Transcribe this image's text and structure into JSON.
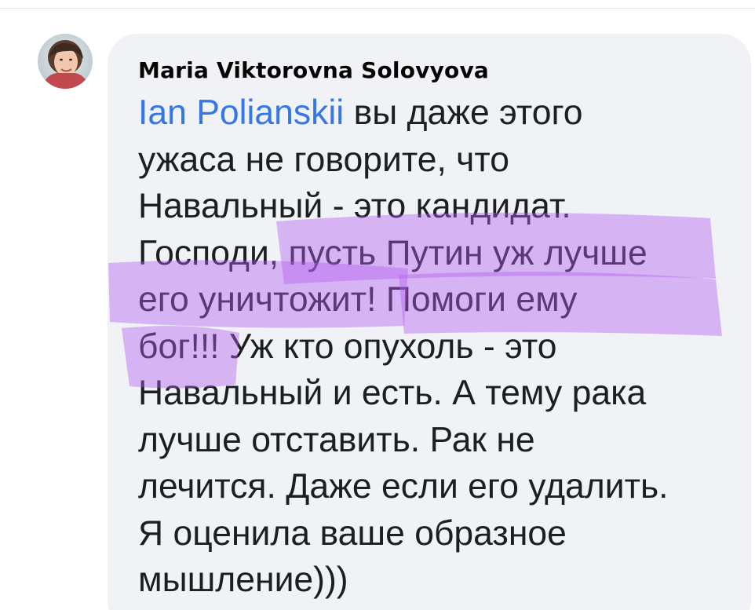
{
  "comment": {
    "author": "Maria Viktorovna Solovyova",
    "mention": "Ian Polianskii",
    "lines": [
      " вы даже этого",
      "ужаса не говорите, что",
      "Навальный - это кандидат.",
      "Господи, пусть Путин уж лучше",
      "его уничтожит! Помоги ему",
      "бог!!! Уж кто опухоль - это",
      "Навальный и есть. А тему рака",
      "лучше отставить. Рак не",
      "лечится. Даже если его удалить.",
      "Я оценила ваше образное",
      "мышление)))"
    ]
  },
  "colors": {
    "bubble_background": "#f0f2f5",
    "mention_link": "#3578e5",
    "text": "#1c1e21",
    "marker_highlight": "#b25cf0"
  },
  "icons": {
    "avatar": "profile-photo-avatar"
  }
}
